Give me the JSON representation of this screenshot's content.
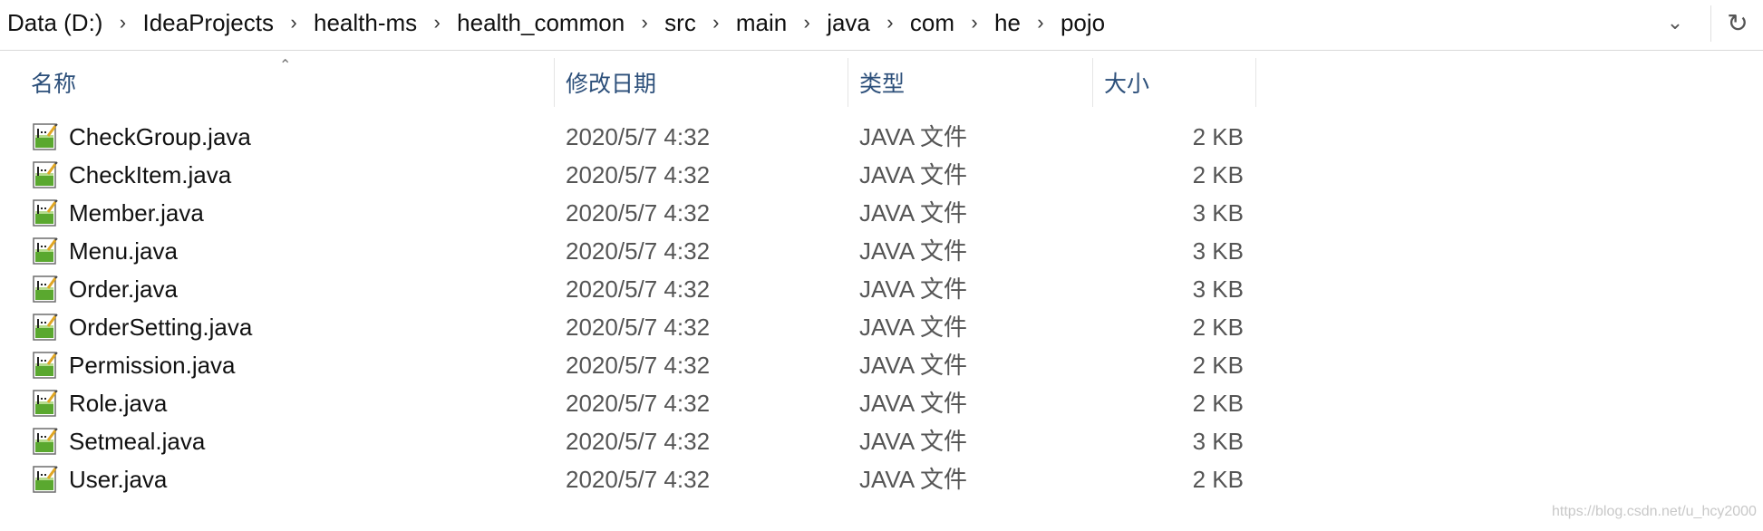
{
  "breadcrumb": {
    "items": [
      "Data (D:)",
      "IdeaProjects",
      "health-ms",
      "health_common",
      "src",
      "main",
      "java",
      "com",
      "he",
      "pojo"
    ]
  },
  "columns": {
    "name": "名称",
    "date": "修改日期",
    "type": "类型",
    "size": "大小"
  },
  "files": [
    {
      "name": "CheckGroup.java",
      "date": "2020/5/7 4:32",
      "type": "JAVA 文件",
      "size": "2 KB"
    },
    {
      "name": "CheckItem.java",
      "date": "2020/5/7 4:32",
      "type": "JAVA 文件",
      "size": "2 KB"
    },
    {
      "name": "Member.java",
      "date": "2020/5/7 4:32",
      "type": "JAVA 文件",
      "size": "3 KB"
    },
    {
      "name": "Menu.java",
      "date": "2020/5/7 4:32",
      "type": "JAVA 文件",
      "size": "3 KB"
    },
    {
      "name": "Order.java",
      "date": "2020/5/7 4:32",
      "type": "JAVA 文件",
      "size": "3 KB"
    },
    {
      "name": "OrderSetting.java",
      "date": "2020/5/7 4:32",
      "type": "JAVA 文件",
      "size": "2 KB"
    },
    {
      "name": "Permission.java",
      "date": "2020/5/7 4:32",
      "type": "JAVA 文件",
      "size": "2 KB"
    },
    {
      "name": "Role.java",
      "date": "2020/5/7 4:32",
      "type": "JAVA 文件",
      "size": "2 KB"
    },
    {
      "name": "Setmeal.java",
      "date": "2020/5/7 4:32",
      "type": "JAVA 文件",
      "size": "3 KB"
    },
    {
      "name": "User.java",
      "date": "2020/5/7 4:32",
      "type": "JAVA 文件",
      "size": "2 KB"
    }
  ],
  "icons": {
    "file": "java-file-icon",
    "dropdown": "chevron-down-icon",
    "refresh": "refresh-icon",
    "separator": "chevron-right-icon",
    "sort": "sort-ascending-icon"
  },
  "watermark": "https://blog.csdn.net/u_hcy2000",
  "colors": {
    "header_text": "#2c4f7a",
    "secondary_text": "#555555",
    "icon_green": "#5aa82f"
  }
}
